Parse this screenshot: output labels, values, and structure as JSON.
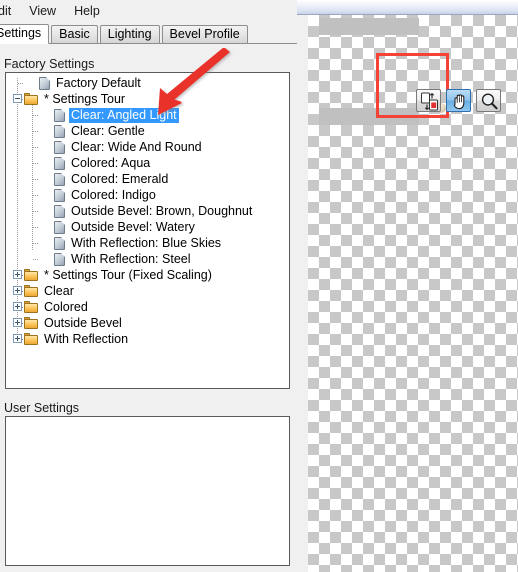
{
  "window": {
    "title_strip": ""
  },
  "menubar": {
    "items": [
      {
        "label": "dit",
        "name": "menu-edit",
        "clipped": true
      },
      {
        "label": "View",
        "name": "menu-view",
        "clipped": false
      },
      {
        "label": "Help",
        "name": "menu-help",
        "clipped": false
      }
    ]
  },
  "tabs": {
    "items": [
      {
        "label": "Settings",
        "active": true
      },
      {
        "label": "Basic",
        "active": false
      },
      {
        "label": "Lighting",
        "active": false
      },
      {
        "label": "Bevel Profile",
        "active": false
      }
    ]
  },
  "factory": {
    "label": "Factory Settings",
    "tree": [
      {
        "label": "Factory Default",
        "type": "document",
        "level": 1,
        "selected": false,
        "expander": "none"
      },
      {
        "label": "* Settings Tour",
        "type": "folder",
        "level": 0,
        "selected": false,
        "expander": "minus"
      },
      {
        "label": "Clear: Angled Light",
        "type": "document",
        "level": 2,
        "selected": true,
        "expander": "none"
      },
      {
        "label": "Clear: Gentle",
        "type": "document",
        "level": 2,
        "selected": false,
        "expander": "none"
      },
      {
        "label": "Clear: Wide And Round",
        "type": "document",
        "level": 2,
        "selected": false,
        "expander": "none"
      },
      {
        "label": "Colored: Aqua",
        "type": "document",
        "level": 2,
        "selected": false,
        "expander": "none"
      },
      {
        "label": "Colored: Emerald",
        "type": "document",
        "level": 2,
        "selected": false,
        "expander": "none"
      },
      {
        "label": "Colored: Indigo",
        "type": "document",
        "level": 2,
        "selected": false,
        "expander": "none"
      },
      {
        "label": "Outside Bevel: Brown, Doughnut",
        "type": "document",
        "level": 2,
        "selected": false,
        "expander": "none"
      },
      {
        "label": "Outside Bevel: Watery",
        "type": "document",
        "level": 2,
        "selected": false,
        "expander": "none"
      },
      {
        "label": "With Reflection: Blue Skies",
        "type": "document",
        "level": 2,
        "selected": false,
        "expander": "none"
      },
      {
        "label": "With Reflection: Steel",
        "type": "document",
        "level": 2,
        "selected": false,
        "expander": "none"
      },
      {
        "label": "* Settings Tour (Fixed Scaling)",
        "type": "folder",
        "level": 0,
        "selected": false,
        "expander": "plus"
      },
      {
        "label": "Clear",
        "type": "folder",
        "level": 0,
        "selected": false,
        "expander": "plus"
      },
      {
        "label": "Colored",
        "type": "folder",
        "level": 0,
        "selected": false,
        "expander": "plus"
      },
      {
        "label": "Outside Bevel",
        "type": "folder",
        "level": 0,
        "selected": false,
        "expander": "plus"
      },
      {
        "label": "With Reflection",
        "type": "folder",
        "level": 0,
        "selected": false,
        "expander": "plus"
      }
    ]
  },
  "user": {
    "label": "User Settings",
    "tree": []
  },
  "preview": {
    "tools": [
      {
        "name": "swap-document-icon",
        "label": "Swap Image",
        "active": false
      },
      {
        "name": "hand-pan-icon",
        "label": "Pan",
        "active": true
      },
      {
        "name": "magnifier-zoom-icon",
        "label": "Zoom",
        "active": false
      }
    ]
  },
  "annotation": {
    "arrow_color": "#e8312a",
    "points_to": "Clear: Angled Light"
  },
  "colors": {
    "selection": "#3399ff",
    "selection_rect": "#f44336",
    "checker": "#c8c8c8",
    "object": "#c0c0c0",
    "folder": "#eda72f"
  }
}
